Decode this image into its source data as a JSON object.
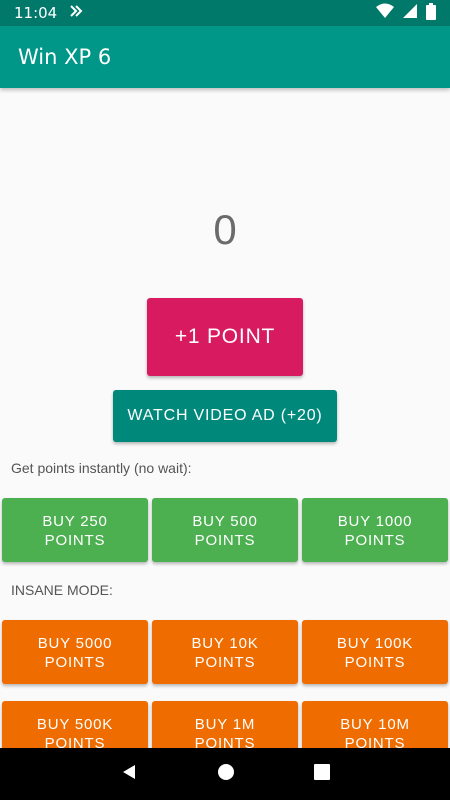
{
  "status_bar": {
    "time": "11:04"
  },
  "app_bar": {
    "title": "Win XP 6"
  },
  "main": {
    "counter": "0",
    "point_button": "+1 POINT",
    "video_button": "WATCH VIDEO AD (+20)",
    "instant_label": "Get points instantly (no wait):",
    "instant_buttons": [
      {
        "line1": "BUY 250",
        "line2": "POINTS"
      },
      {
        "line1": "BUY 500",
        "line2": "POINTS"
      },
      {
        "line1": "BUY 1000",
        "line2": "POINTS"
      }
    ],
    "insane_label": "INSANE MODE:",
    "insane_buttons_row1": [
      {
        "line1": "BUY 5000",
        "line2": "POINTS"
      },
      {
        "line1": "BUY 10K",
        "line2": "POINTS"
      },
      {
        "line1": "BUY 100K",
        "line2": "POINTS"
      }
    ],
    "insane_buttons_row2": [
      {
        "line1": "BUY 500K",
        "line2": "POINTS"
      },
      {
        "line1": "BUY 1M",
        "line2": "POINTS"
      },
      {
        "line1": "BUY 10M",
        "line2": "POINTS"
      }
    ]
  },
  "colors": {
    "status_bar": "#00796b",
    "app_bar": "#009688",
    "point_button": "#d81b60",
    "video_button": "#00897b",
    "green_button": "#4caf50",
    "orange_button": "#ef6c00"
  },
  "icons": {
    "status": [
      "notification-icon",
      "wifi-icon",
      "signal-icon",
      "battery-icon"
    ],
    "nav": [
      "back-icon",
      "home-icon",
      "recents-icon"
    ]
  }
}
